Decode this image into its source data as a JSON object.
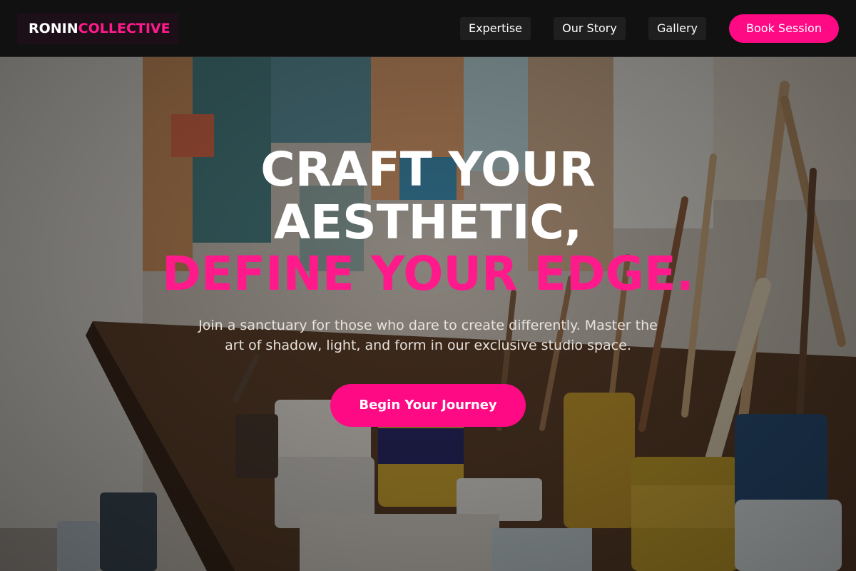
{
  "brand": {
    "part1": "RONIN",
    "part2": "COLLECTIVE"
  },
  "nav": {
    "links": [
      "Expertise",
      "Our Story",
      "Gallery"
    ],
    "cta": "Book Session"
  },
  "hero": {
    "line1": "CRAFT YOUR",
    "line2": "AESTHETIC,",
    "line3": "DEFINE YOUR EDGE.",
    "subtext": "Join a sanctuary for those who dare to create differently. Master the art of shadow, light, and form in our exclusive studio space.",
    "cta": "Begin Your Journey"
  },
  "colors": {
    "accent": "#ff0a85",
    "nav_bg": "#111111",
    "text": "#ffffff"
  }
}
